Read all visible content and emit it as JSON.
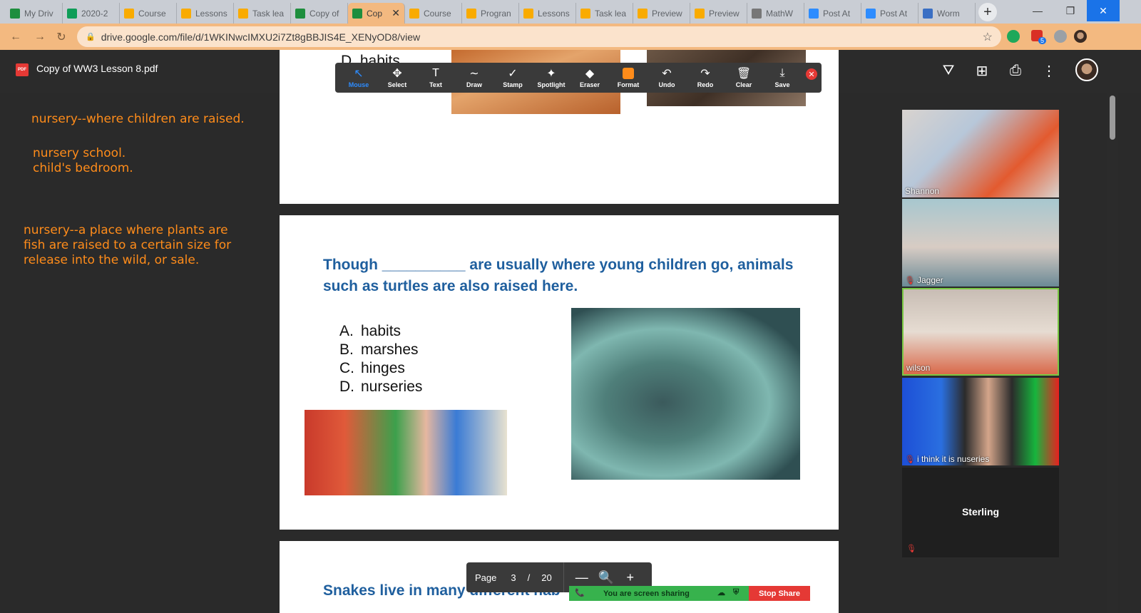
{
  "browser": {
    "tabs": [
      {
        "label": "My Driv",
        "icon": "drive-icon",
        "color": "#1e8e3e"
      },
      {
        "label": "2020-2",
        "icon": "sheets-icon",
        "color": "#0f9d58"
      },
      {
        "label": "Course",
        "icon": "classroom-icon",
        "color": "#f9ab00"
      },
      {
        "label": "Lessons",
        "icon": "classroom-icon",
        "color": "#f9ab00"
      },
      {
        "label": "Task lea",
        "icon": "classroom-icon",
        "color": "#f9ab00"
      },
      {
        "label": "Copy of",
        "icon": "drive-icon",
        "color": "#1e8e3e"
      },
      {
        "label": "Cop",
        "icon": "drive-icon",
        "color": "#1e8e3e",
        "active": true
      },
      {
        "label": "Course",
        "icon": "classroom-icon",
        "color": "#f9ab00"
      },
      {
        "label": "Progran",
        "icon": "classroom-icon",
        "color": "#f9ab00"
      },
      {
        "label": "Lessons",
        "icon": "classroom-icon",
        "color": "#f9ab00"
      },
      {
        "label": "Task lea",
        "icon": "classroom-icon",
        "color": "#f9ab00"
      },
      {
        "label": "Preview",
        "icon": "classroom-icon",
        "color": "#f9ab00"
      },
      {
        "label": "Preview",
        "icon": "classroom-icon",
        "color": "#f9ab00"
      },
      {
        "label": "MathW",
        "icon": "globe-icon",
        "color": "#777777"
      },
      {
        "label": "Post At",
        "icon": "zoom-icon",
        "color": "#2d8cff"
      },
      {
        "label": "Post At",
        "icon": "zoom-icon",
        "color": "#2d8cff"
      },
      {
        "label": "Worm",
        "icon": "brain-icon",
        "color": "#3a6fc4"
      }
    ],
    "new_tab_label": "+",
    "url": "drive.google.com/file/d/1WKINwcIMXU2i7Zt8gBBJIS4E_XENyOD8/view",
    "extension_badge": "5"
  },
  "viewer": {
    "pdf_badge": "PDF",
    "title": "Copy of WW3 Lesson 8.pdf"
  },
  "notes": {
    "note1": "nursery--where children are raised.",
    "note2": "nursery school.\nchild's bedroom.",
    "note3": "nursery--a place where plants are\nfish are raised to a certain size for\nrelease into the wild, or sale."
  },
  "pdf": {
    "prev_option_fragment": "D. habits",
    "question": "Though __________ are usually where young children go, animals such as turtles are also raised here.",
    "options": [
      {
        "letter": "A.",
        "text": "habits"
      },
      {
        "letter": "B.",
        "text": "marshes"
      },
      {
        "letter": "C.",
        "text": "hinges"
      },
      {
        "letter": "D.",
        "text": "nurseries"
      }
    ],
    "next_question": "Snakes live in many different hab"
  },
  "annotation_toolbar": {
    "tools": [
      {
        "label": "Mouse",
        "icon": "mouse-arrow-icon",
        "glyph": "↖",
        "active": true
      },
      {
        "label": "Select",
        "icon": "select-move-icon",
        "glyph": "✥"
      },
      {
        "label": "Text",
        "icon": "text-icon",
        "glyph": "T"
      },
      {
        "label": "Draw",
        "icon": "draw-icon",
        "glyph": "∼"
      },
      {
        "label": "Stamp",
        "icon": "stamp-check-icon",
        "glyph": "✓"
      },
      {
        "label": "Spotlight",
        "icon": "spotlight-icon",
        "glyph": "✦"
      },
      {
        "label": "Eraser",
        "icon": "eraser-icon",
        "glyph": "◆"
      },
      {
        "label": "Format",
        "icon": "format-swatch-icon",
        "glyph": ""
      },
      {
        "label": "Undo",
        "icon": "undo-icon",
        "glyph": "↶"
      },
      {
        "label": "Redo",
        "icon": "redo-icon",
        "glyph": "↷"
      },
      {
        "label": "Clear",
        "icon": "trash-icon",
        "glyph": "🗑"
      },
      {
        "label": "Save",
        "icon": "save-download-icon",
        "glyph": "⤓"
      }
    ],
    "format_color": "#ff8c1a"
  },
  "participants": [
    {
      "name": "Shannon",
      "muted": false
    },
    {
      "name": "Jagger",
      "muted": true
    },
    {
      "name": "wilson",
      "muted": false
    },
    {
      "name": "i think it is nuseries",
      "muted": true
    },
    {
      "name": "Sterling",
      "muted": true
    }
  ],
  "page_controls": {
    "label": "Page",
    "current": "3",
    "separator": "/",
    "total": "20",
    "zoom_out": "—",
    "zoom_in": "+"
  },
  "share_bar": {
    "message": "You are screen sharing",
    "stop_label": "Stop Share"
  }
}
